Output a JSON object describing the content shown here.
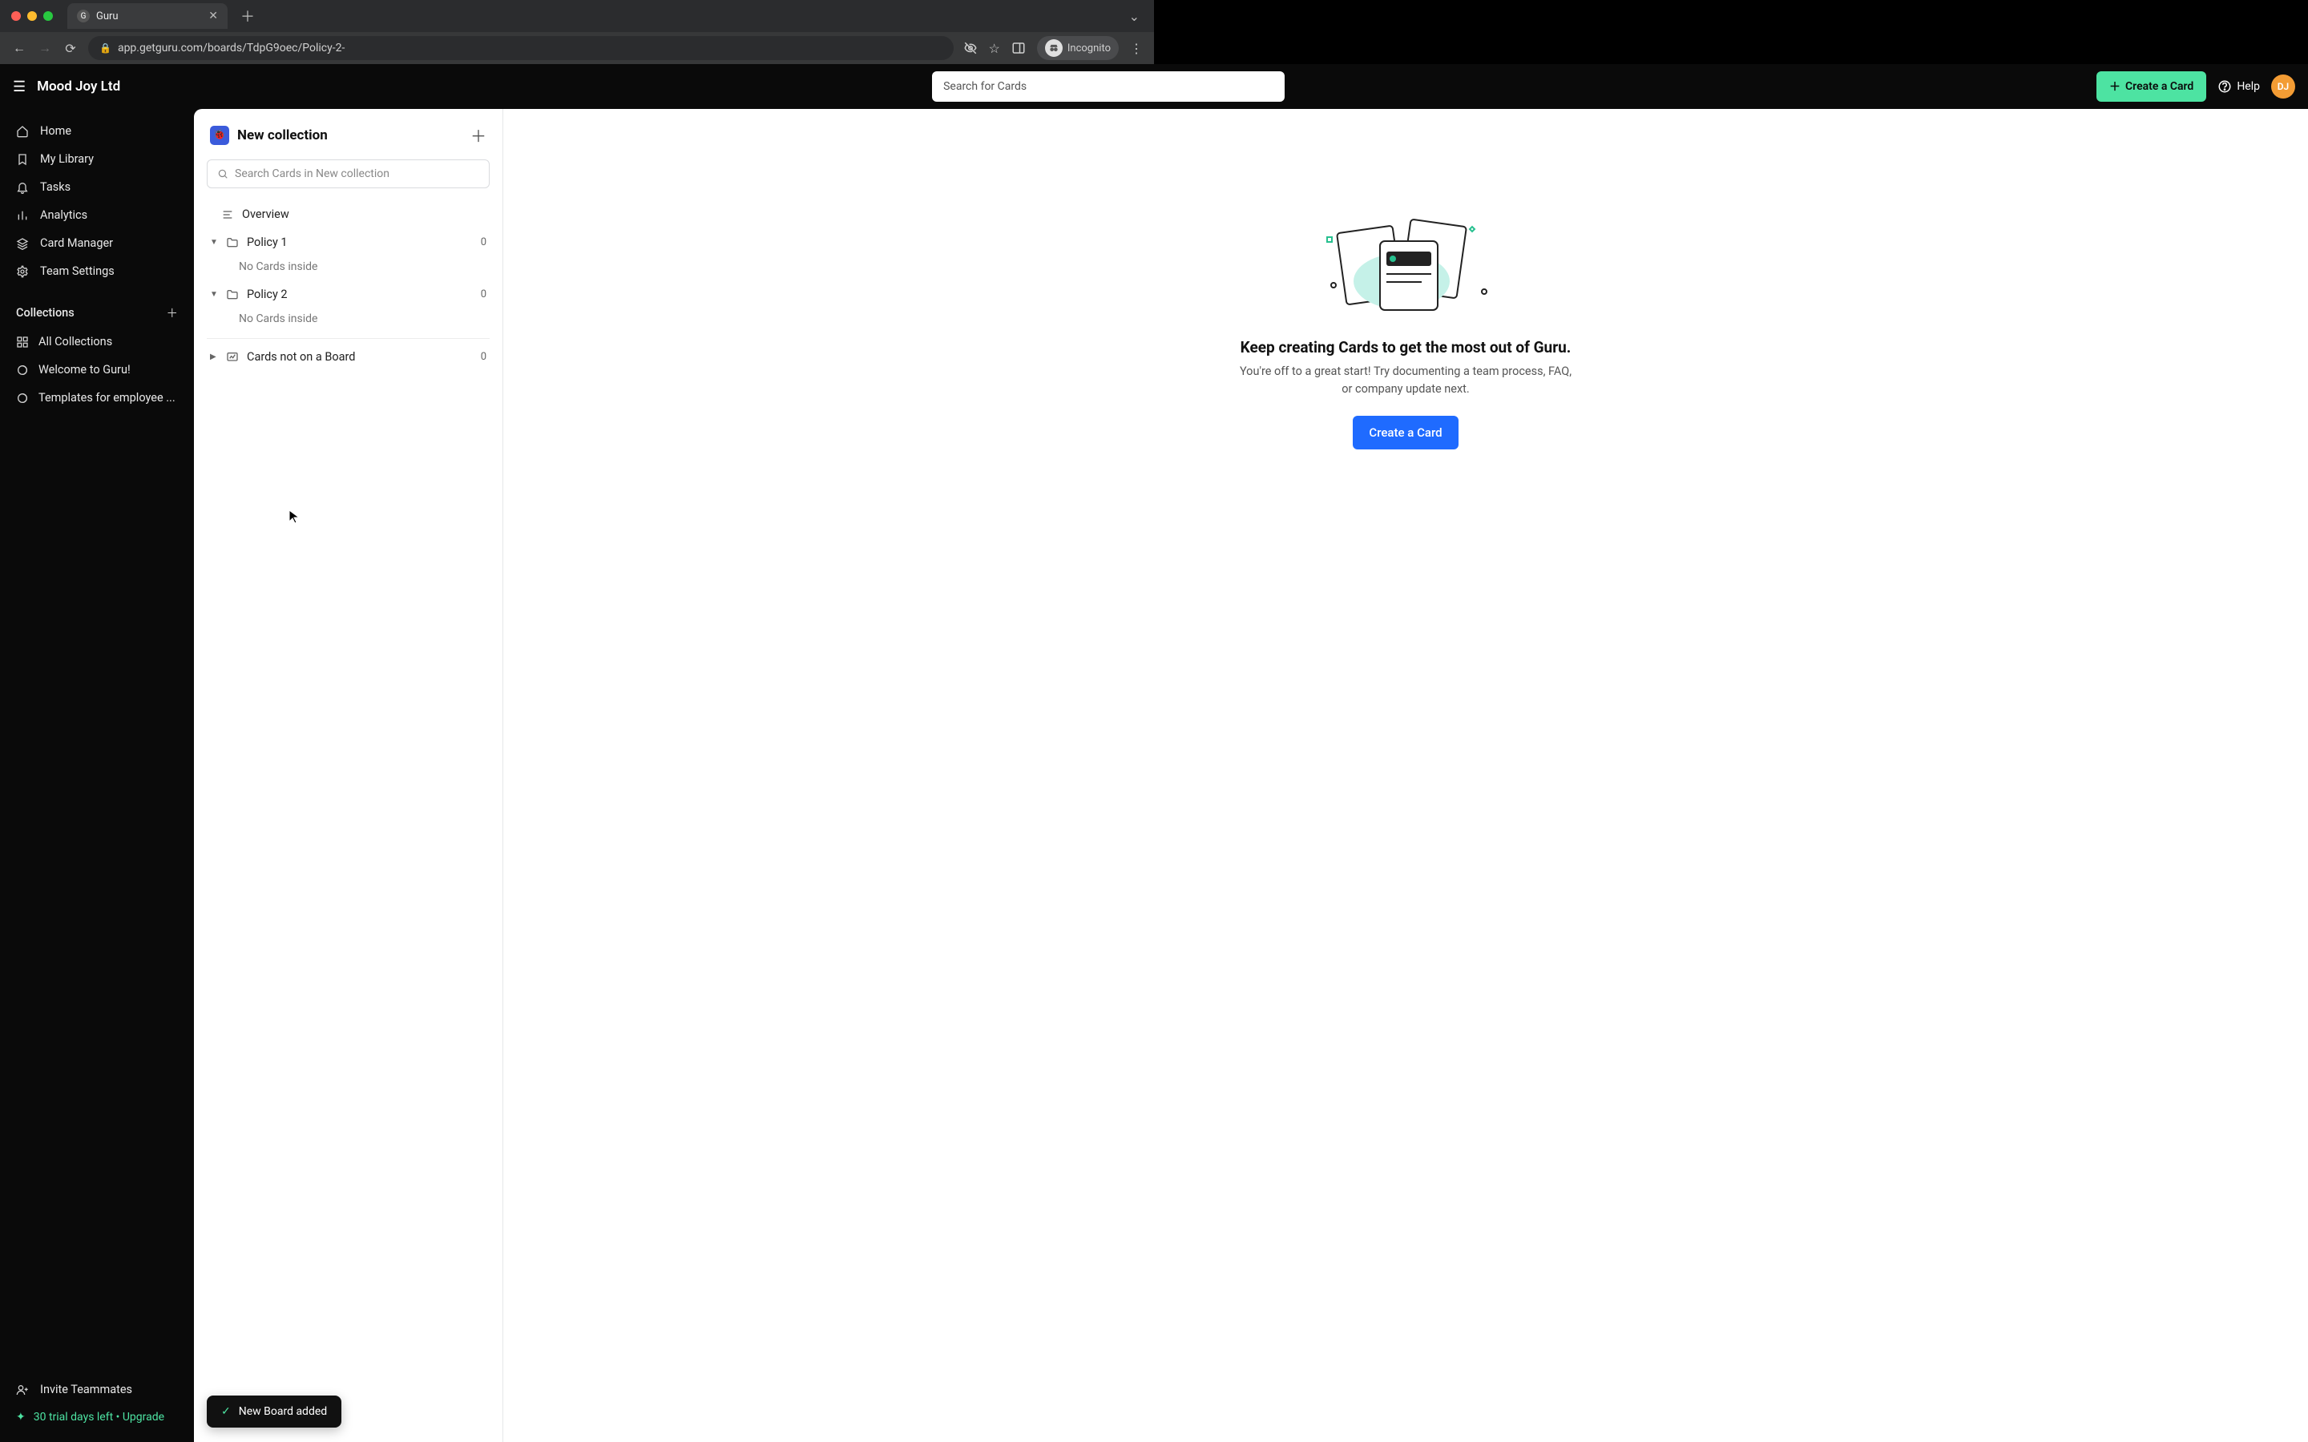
{
  "browser": {
    "tab_title": "Guru",
    "url": "app.getguru.com/boards/TdpG9oec/Policy-2-",
    "incognito_label": "Incognito"
  },
  "topbar": {
    "org_name": "Mood Joy Ltd",
    "search_placeholder": "Search for Cards",
    "create_card_label": "Create a Card",
    "help_label": "Help",
    "avatar_initials": "DJ"
  },
  "sidebar": {
    "nav": [
      {
        "icon": "home",
        "label": "Home"
      },
      {
        "icon": "bookmark",
        "label": "My Library"
      },
      {
        "icon": "bell",
        "label": "Tasks"
      },
      {
        "icon": "chart",
        "label": "Analytics"
      },
      {
        "icon": "layers",
        "label": "Card Manager"
      },
      {
        "icon": "gear",
        "label": "Team Settings"
      }
    ],
    "collections_header": "Collections",
    "collections": [
      {
        "icon": "grid",
        "label": "All Collections"
      },
      {
        "icon": "logo",
        "label": "Welcome to Guru!"
      },
      {
        "icon": "logo",
        "label": "Templates for employee ..."
      }
    ],
    "invite_label": "Invite Teammates",
    "trial_label": "30 trial days left • Upgrade"
  },
  "collection_panel": {
    "title": "New collection",
    "search_placeholder": "Search Cards in New collection",
    "overview_label": "Overview",
    "boards": [
      {
        "name": "Policy 1",
        "count": "0",
        "empty_msg": "No Cards inside",
        "expanded": true
      },
      {
        "name": "Policy 2",
        "count": "0",
        "empty_msg": "No Cards inside",
        "expanded": true
      }
    ],
    "unboarded": {
      "label": "Cards not on a Board",
      "count": "0"
    },
    "toast": "New Board added"
  },
  "hero": {
    "title": "Keep creating Cards to get the most out of Guru.",
    "subtitle": "You're off to a great start! Try documenting a team process, FAQ, or company update next.",
    "cta": "Create a Card"
  }
}
